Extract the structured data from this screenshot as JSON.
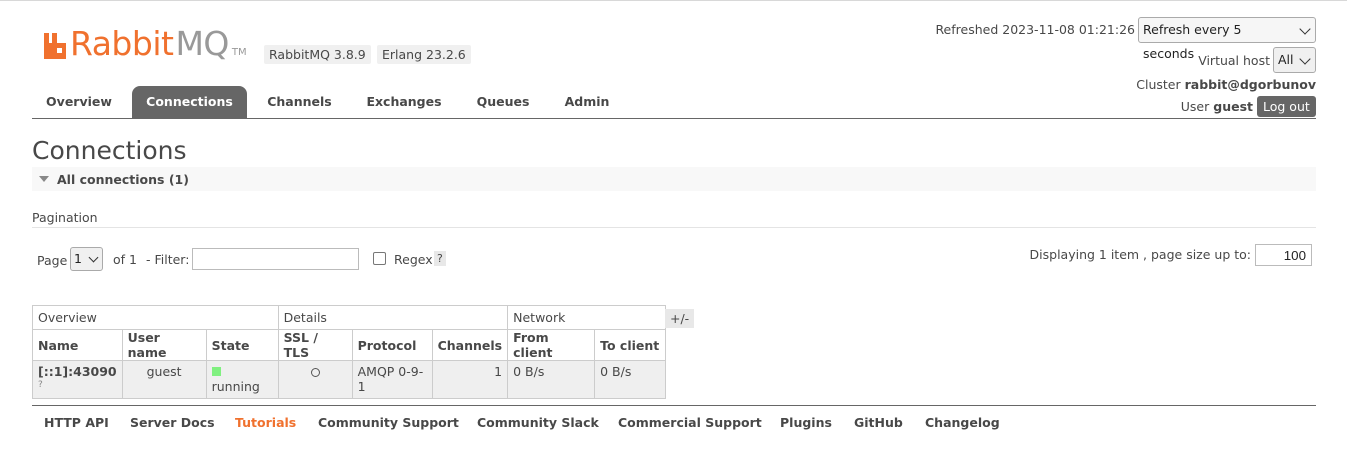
{
  "header": {
    "logo_text_rabbit": "Rabbit",
    "logo_text_mq": "MQ",
    "logo_tm": "TM",
    "rabbitmq_version": "RabbitMQ 3.8.9",
    "erlang_version": "Erlang 23.2.6",
    "refreshed_text": "Refreshed 2023-11-08 01:21:26",
    "refresh_select": "Refresh every 5 seconds",
    "virtual_host_label": "Virtual host",
    "virtual_host_value": "All",
    "cluster_label": "Cluster",
    "cluster_value": "rabbit@dgorbunov",
    "user_label": "User",
    "user_value": "guest",
    "logout_label": "Log out"
  },
  "nav": {
    "tabs": [
      "Overview",
      "Connections",
      "Channels",
      "Exchanges",
      "Queues",
      "Admin"
    ],
    "active": "Connections"
  },
  "page": {
    "title": "Connections",
    "section_label": "All connections (1)"
  },
  "pagination": {
    "label": "Pagination",
    "page_label": "Page",
    "page_value": "1",
    "of_label": "of 1",
    "filter_label": "- Filter:",
    "filter_value": "",
    "regex_label": "Regex",
    "regex_help": "?",
    "displaying_text": "Displaying 1 item , page size up to:",
    "page_size": "100"
  },
  "table": {
    "groups": [
      "Overview",
      "Details",
      "Network"
    ],
    "columns": [
      "Name",
      "User name",
      "State",
      "SSL / TLS",
      "Protocol",
      "Channels",
      "From client",
      "To client"
    ],
    "rows": [
      {
        "name": "[::1]:43090",
        "name_sub": "?",
        "user": "guest",
        "state": "running",
        "ssl": "○",
        "protocol": "AMQP 0-9-1",
        "channels": "1",
        "from_client": "0 B/s",
        "to_client": "0 B/s"
      }
    ],
    "columns_toggle": "+/-"
  },
  "footer": {
    "links": [
      "HTTP API",
      "Server Docs",
      "Tutorials",
      "Community Support",
      "Community Slack",
      "Commercial Support",
      "Plugins",
      "GitHub",
      "Changelog"
    ],
    "highlighted": "Tutorials"
  },
  "colors": {
    "brand_orange": "#f0712e",
    "tab_active_bg": "#666666",
    "state_running": "#80f080"
  }
}
